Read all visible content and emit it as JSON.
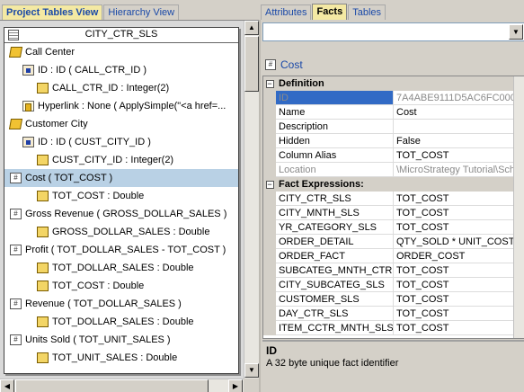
{
  "left_tabs": [
    "Project Tables View",
    "Hierarchy View"
  ],
  "right_tabs": [
    "Attributes",
    "Facts",
    "Tables"
  ],
  "table": {
    "name": "CITY_CTR_SLS",
    "rows": [
      {
        "indent": 0,
        "icon": "attribute-icon",
        "text": "Call Center"
      },
      {
        "indent": 1,
        "icon": "key-icon",
        "text": "ID : ID ( CALL_CTR_ID )"
      },
      {
        "indent": 2,
        "icon": "column-icon",
        "text": "CALL_CTR_ID : Integer(2)"
      },
      {
        "indent": 1,
        "icon": "form-icon",
        "text": "Hyperlink : None ( ApplySimple(\"<a href=..."
      },
      {
        "indent": 0,
        "icon": "attribute-icon",
        "text": "Customer City"
      },
      {
        "indent": 1,
        "icon": "key-icon",
        "text": "ID : ID ( CUST_CITY_ID )"
      },
      {
        "indent": 2,
        "icon": "column-icon",
        "text": "CUST_CITY_ID : Integer(2)"
      },
      {
        "indent": 0,
        "icon": "fact-icon",
        "text": "Cost ( TOT_COST )",
        "selected": true
      },
      {
        "indent": 2,
        "icon": "column-icon",
        "text": "TOT_COST : Double"
      },
      {
        "indent": 0,
        "icon": "fact-icon",
        "text": "Gross Revenue ( GROSS_DOLLAR_SALES )"
      },
      {
        "indent": 2,
        "icon": "column-icon",
        "text": "GROSS_DOLLAR_SALES : Double"
      },
      {
        "indent": 0,
        "icon": "fact-icon",
        "text": "Profit ( TOT_DOLLAR_SALES - TOT_COST )"
      },
      {
        "indent": 2,
        "icon": "column-icon",
        "text": "TOT_DOLLAR_SALES : Double"
      },
      {
        "indent": 2,
        "icon": "column-icon",
        "text": "TOT_COST : Double"
      },
      {
        "indent": 0,
        "icon": "fact-icon",
        "text": "Revenue ( TOT_DOLLAR_SALES )"
      },
      {
        "indent": 2,
        "icon": "column-icon",
        "text": "TOT_DOLLAR_SALES : Double"
      },
      {
        "indent": 0,
        "icon": "fact-icon",
        "text": "Units Sold ( TOT_UNIT_SALES )"
      },
      {
        "indent": 2,
        "icon": "column-icon",
        "text": "TOT_UNIT_SALES : Double"
      }
    ]
  },
  "properties": {
    "object_name": "Cost",
    "combo_value": "",
    "rows": [
      {
        "type": "category",
        "label": "Definition"
      },
      {
        "key": "ID",
        "value": "7A4ABE9111D5AC6FC000",
        "selected": true,
        "dim": true
      },
      {
        "key": "Name",
        "value": "Cost"
      },
      {
        "key": "Description",
        "value": ""
      },
      {
        "key": "Hidden",
        "value": "False"
      },
      {
        "key": "Column Alias",
        "value": "TOT_COST"
      },
      {
        "key": "Location",
        "value": "\\MicroStrategy Tutorial\\Sch",
        "dim": true
      },
      {
        "type": "category",
        "label": "Fact Expressions:"
      },
      {
        "key": "CITY_CTR_SLS",
        "value": "TOT_COST"
      },
      {
        "key": "CITY_MNTH_SLS",
        "value": "TOT_COST"
      },
      {
        "key": "YR_CATEGORY_SLS",
        "value": "TOT_COST"
      },
      {
        "key": "ORDER_DETAIL",
        "value": "QTY_SOLD * UNIT_COST"
      },
      {
        "key": "ORDER_FACT",
        "value": "ORDER_COST"
      },
      {
        "key": "SUBCATEG_MNTH_CTR",
        "value": "TOT_COST"
      },
      {
        "key": "CITY_SUBCATEG_SLS",
        "value": "TOT_COST"
      },
      {
        "key": "CUSTOMER_SLS",
        "value": "TOT_COST"
      },
      {
        "key": "DAY_CTR_SLS",
        "value": "TOT_COST"
      },
      {
        "key": "ITEM_CCTR_MNTH_SLS",
        "value": "TOT_COST"
      }
    ]
  },
  "description_panel": {
    "title": "ID",
    "text": "A 32 byte unique fact identifier"
  },
  "icons": {
    "scroll_up": "▲",
    "scroll_down": "▼",
    "scroll_left": "◀",
    "scroll_right": "▶",
    "dropdown": "▼",
    "collapse": "−",
    "fact_glyph": "#"
  }
}
